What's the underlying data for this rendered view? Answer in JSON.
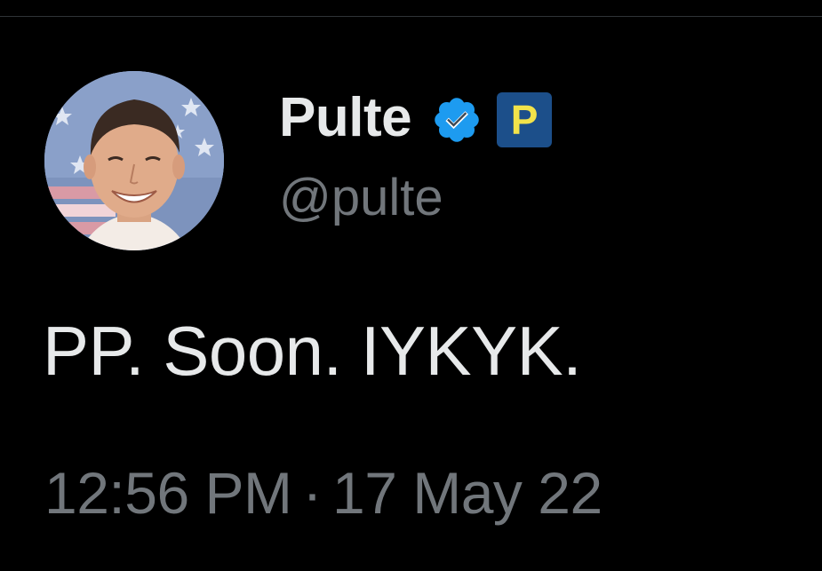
{
  "tweet": {
    "author": {
      "display_name": "Pulte",
      "handle": "@pulte",
      "verified": true,
      "verified_icon": "verified-badge-icon",
      "affiliate_badge_letter": "P",
      "affiliate_badge_color": "#1c4f8a",
      "affiliate_badge_text_color": "#f2e34a"
    },
    "text": "PP. Soon. IYKYK.",
    "meta": {
      "time": "12:56 PM",
      "separator": "·",
      "date": "17 May 22"
    }
  },
  "colors": {
    "background": "#000000",
    "primary_text": "#e7e9ea",
    "secondary_text": "#71767b",
    "verified_blue": "#1d9bf0",
    "divider": "#2f3336"
  }
}
